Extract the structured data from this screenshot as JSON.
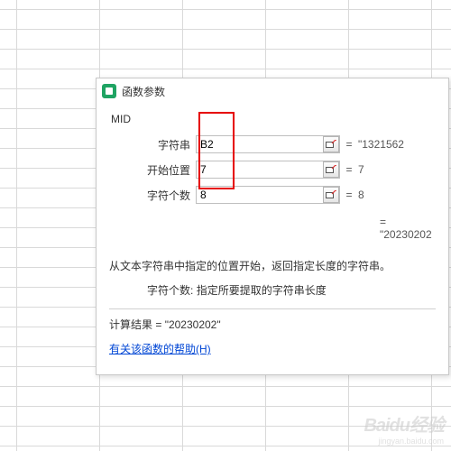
{
  "dialog": {
    "title": "函数参数",
    "function_name": "MID",
    "args": [
      {
        "label": "字符串",
        "value": "B2",
        "preview": "\"1321562"
      },
      {
        "label": "开始位置",
        "value": "7",
        "preview": "7"
      },
      {
        "label": "字符个数",
        "value": "8",
        "preview": "8"
      }
    ],
    "result_preview": "\"20230202",
    "description": "从文本字符串中指定的位置开始，返回指定长度的字符串。",
    "arg_help_label": "字符个数:",
    "arg_help_text": "指定所要提取的字符串长度",
    "calc_label": "计算结果 =",
    "calc_value": "\"20230202\"",
    "help_link": "有关该函数的帮助(H)",
    "eq": "="
  },
  "watermark": {
    "brand": "Baidu经验",
    "sub": "jingyan.baidu.com"
  }
}
